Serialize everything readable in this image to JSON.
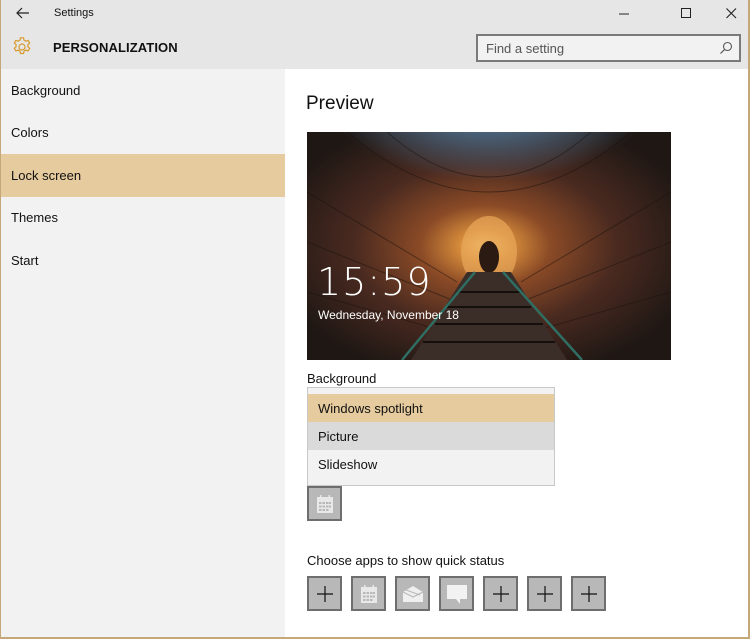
{
  "window": {
    "title": "Settings",
    "controls": {
      "minimize": "minimize-icon",
      "maximize": "maximize-icon",
      "close": "close-icon"
    }
  },
  "header": {
    "title": "PERSONALIZATION",
    "icon": "gear-icon",
    "search": {
      "placeholder": "Find a setting",
      "value": ""
    }
  },
  "sidebar": {
    "items": [
      {
        "label": "Background",
        "active": false
      },
      {
        "label": "Colors",
        "active": false
      },
      {
        "label": "Lock screen",
        "active": true
      },
      {
        "label": "Themes",
        "active": false
      },
      {
        "label": "Start",
        "active": false
      }
    ]
  },
  "main": {
    "preview_title": "Preview",
    "lock_preview": {
      "time": "15:59",
      "date": "Wednesday, November 18"
    },
    "background": {
      "label": "Background",
      "options": [
        {
          "label": "Windows spotlight",
          "state": "selected"
        },
        {
          "label": "Picture",
          "state": "hover"
        },
        {
          "label": "Slideshow",
          "state": "normal"
        }
      ]
    },
    "detailed_status_app": {
      "icon": "calendar-icon"
    },
    "quick_status": {
      "label": "Choose apps to show quick status",
      "apps": [
        {
          "icon": "plus-icon"
        },
        {
          "icon": "calendar-icon"
        },
        {
          "icon": "mail-icon"
        },
        {
          "icon": "message-icon"
        },
        {
          "icon": "plus-icon"
        },
        {
          "icon": "plus-icon"
        },
        {
          "icon": "plus-icon"
        }
      ]
    }
  },
  "colors": {
    "accent": "#e6cb9e",
    "gear": "#d89a2a",
    "window_border": "#c4a87a"
  }
}
